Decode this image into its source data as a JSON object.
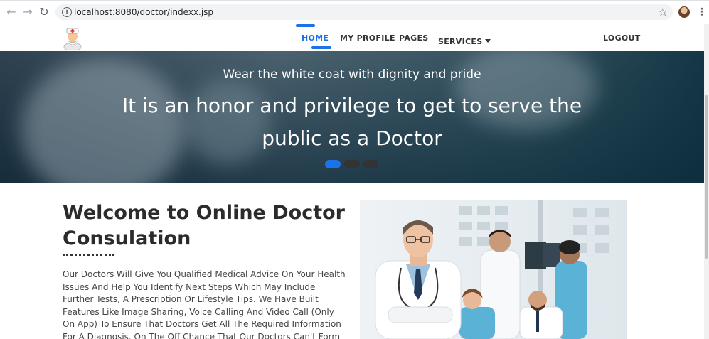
{
  "browser": {
    "url": "localhost:8080/doctor/indexx.jsp",
    "back_icon": "arrow-left",
    "forward_icon": "arrow-right",
    "reload_icon": "reload",
    "bookmark_icon": "star",
    "menu_icon": "kebab"
  },
  "nav": {
    "items": [
      {
        "label": "HOME",
        "active": true
      },
      {
        "label": "MY PROFILE"
      },
      {
        "label": "PAGES"
      },
      {
        "label": "SERVICES"
      }
    ],
    "logout": "LOGOUT",
    "accent": "#1a73e8"
  },
  "hero": {
    "subtitle": "Wear the white coat with dignity and pride",
    "title": "It is an honor and privilege to get to serve the public as a Doctor",
    "active_slide": 1,
    "slide_count": 3
  },
  "welcome": {
    "title": "Welcome to Online Doctor Consulation",
    "body": "Our Doctors Will Give You Qualified Medical Advice On Your Health Issues And Help You Identify Next Steps Which May Include Further Tests, A Prescription Or Lifestyle Tips. We Have Built Features Like Image Sharing, Voice Calling And Video Call (Only On App) To Ensure That Doctors Get All The Required Information For A Diagnosis. On The Off Chance That Our Doctors Can't Form A Conclusive Diagnosis Without A Physical"
  }
}
